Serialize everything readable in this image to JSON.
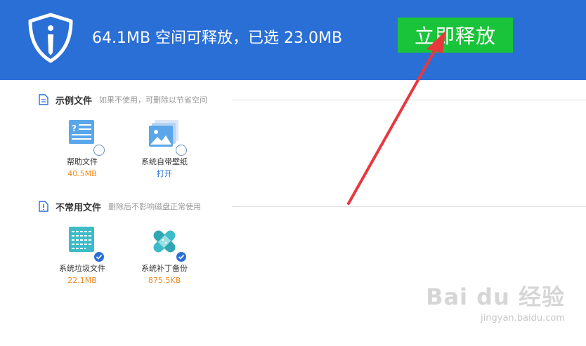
{
  "header": {
    "summary": "64.1MB 空间可释放，已选 23.0MB",
    "release_button": "立即释放"
  },
  "sections": [
    {
      "title": "示例文件",
      "subtitle": "如果不使用，可删除以节省空间",
      "items": [
        {
          "label": "帮助文件",
          "size": "40.5MB",
          "checked": false,
          "icon": "help-document-icon"
        },
        {
          "label": "系统自带壁纸",
          "action": "打开",
          "checked": false,
          "icon": "wallpaper-icon"
        }
      ]
    },
    {
      "title": "不常用文件",
      "subtitle": "删除后不影响磁盘正常使用",
      "items": [
        {
          "label": "系统垃圾文件",
          "size": "22.1MB",
          "checked": true,
          "icon": "junk-file-icon"
        },
        {
          "label": "系统补丁备份",
          "size": "875.5KB",
          "checked": true,
          "icon": "patch-bandage-icon"
        }
      ]
    }
  ],
  "watermark": {
    "logo": "Bai du 经验",
    "url": "jingyan.baidu.com"
  },
  "colors": {
    "header_bg": "#2a6fd6",
    "button_green": "#19c33a",
    "size_orange": "#f08a24",
    "link_blue": "#2a6fd6",
    "annotation_arrow": "#e8383d"
  }
}
